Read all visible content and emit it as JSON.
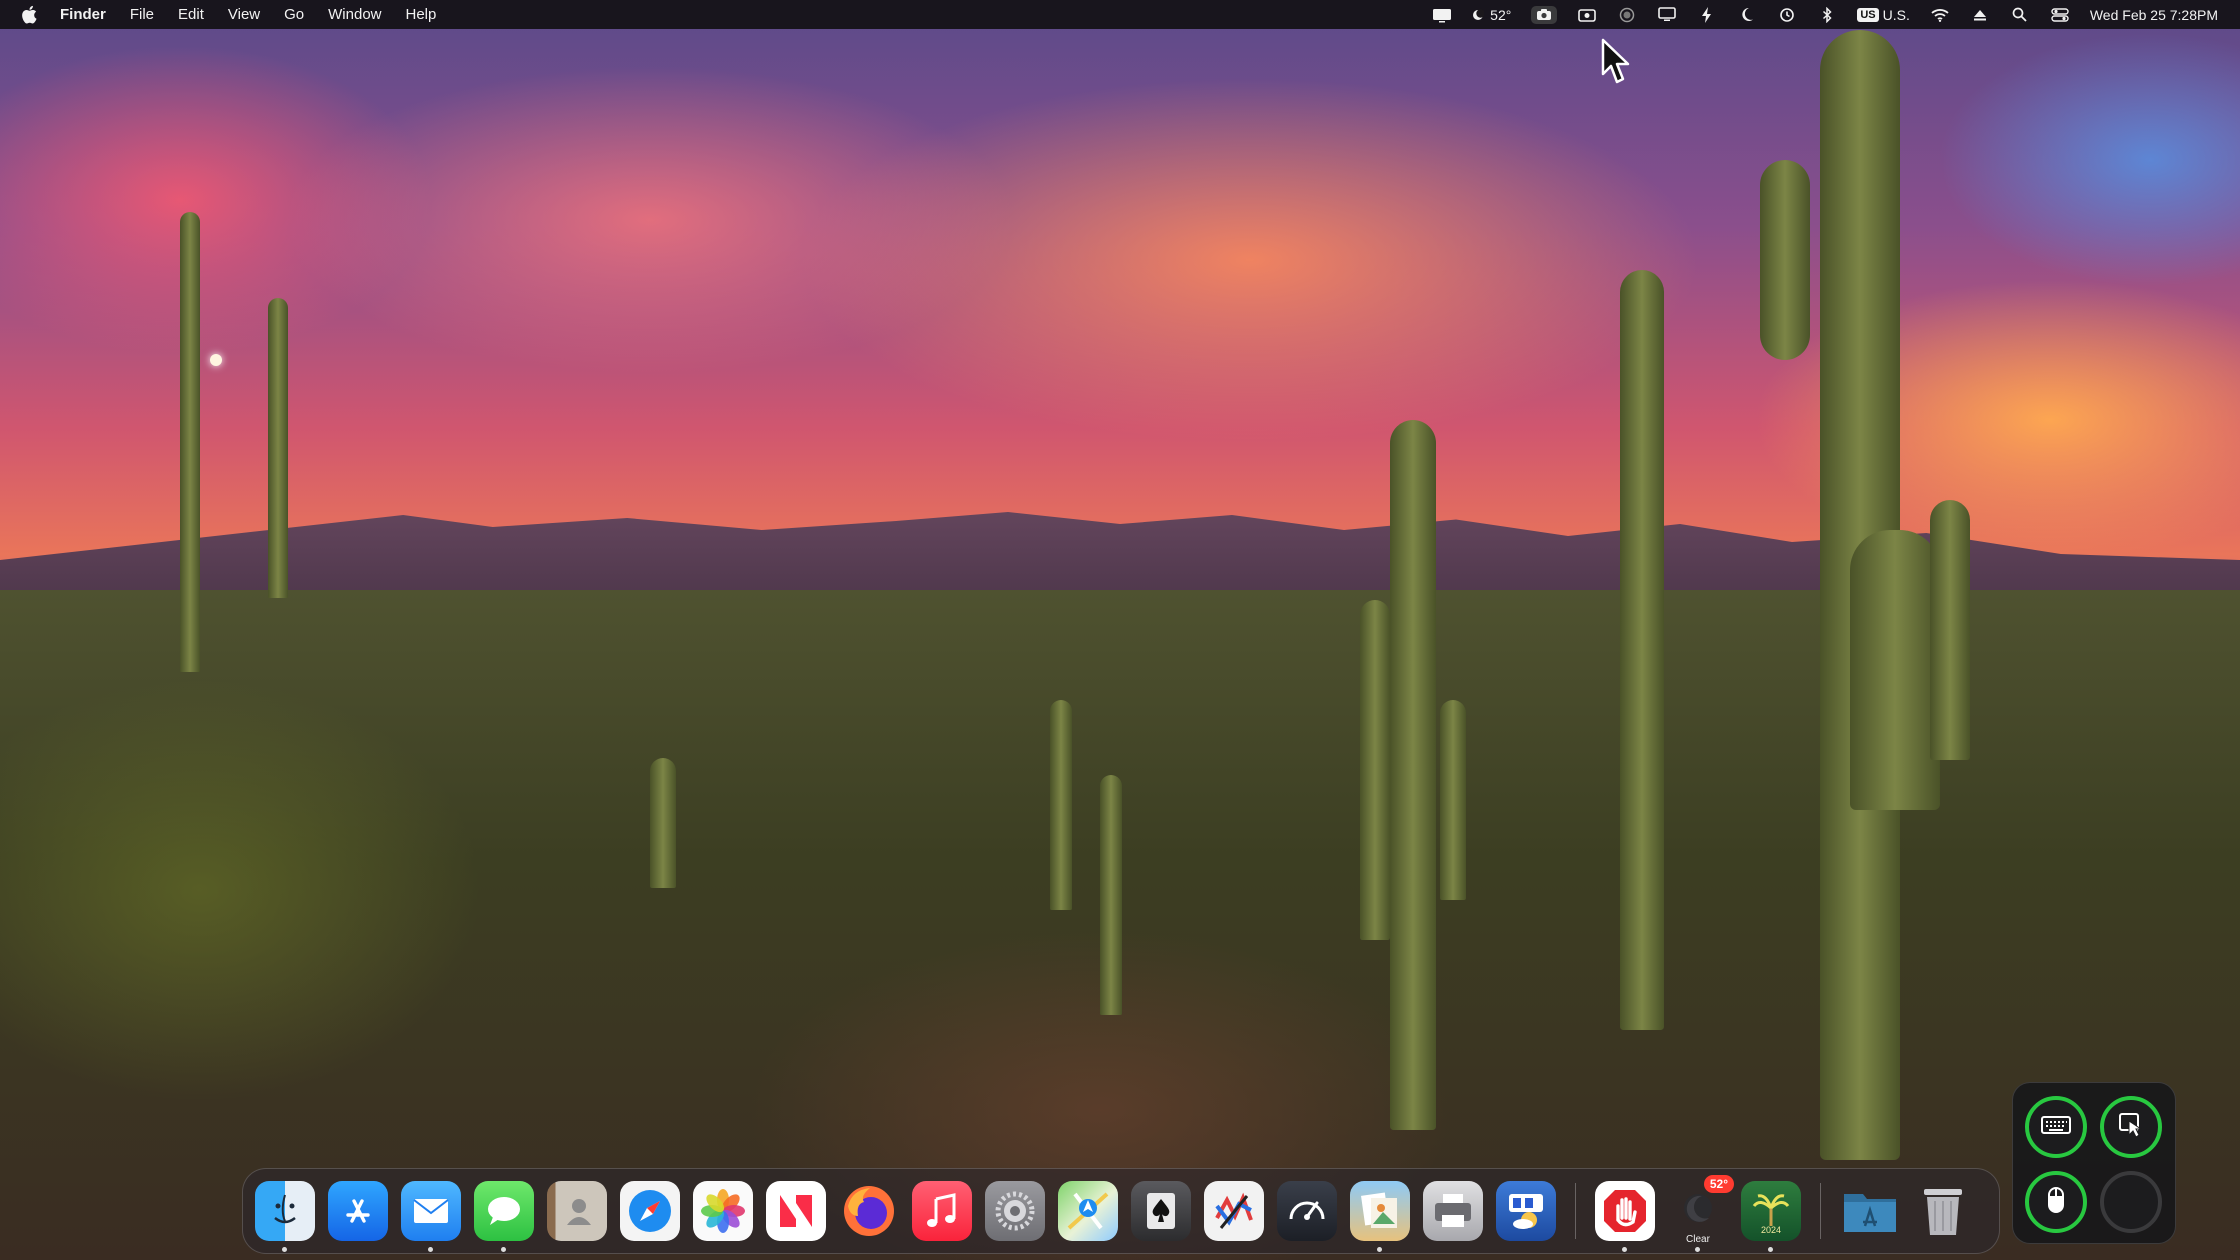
{
  "menubar": {
    "apple_icon": "apple-logo-icon",
    "items": [
      {
        "label": "Finder"
      },
      {
        "label": "File"
      },
      {
        "label": "Edit"
      },
      {
        "label": "View"
      },
      {
        "label": "Go"
      },
      {
        "label": "Window"
      },
      {
        "label": "Help"
      }
    ],
    "status": {
      "weather_temp": "52°",
      "keyboard_flag": "US",
      "keyboard_label": "U.S.",
      "datetime": "Wed Feb 25  7:28PM"
    }
  },
  "dock": {
    "apps": [
      {
        "name": "Finder",
        "icon": "finder-icon",
        "running": true
      },
      {
        "name": "App Store",
        "icon": "app-store-icon",
        "running": false
      },
      {
        "name": "Mail",
        "icon": "mail-icon",
        "running": true
      },
      {
        "name": "Messages",
        "icon": "messages-icon",
        "running": true
      },
      {
        "name": "Contacts",
        "icon": "contacts-icon",
        "running": false
      },
      {
        "name": "Safari",
        "icon": "safari-icon",
        "running": false
      },
      {
        "name": "Photos",
        "icon": "photos-icon",
        "running": false
      },
      {
        "name": "News",
        "icon": "news-icon",
        "running": false
      },
      {
        "name": "Firefox",
        "icon": "firefox-icon",
        "running": false
      },
      {
        "name": "Music",
        "icon": "music-icon",
        "running": false
      },
      {
        "name": "System Settings",
        "icon": "settings-gear-icon",
        "running": false
      },
      {
        "name": "Maps",
        "icon": "maps-icon",
        "running": false
      },
      {
        "name": "Solitaire",
        "icon": "spade-card-icon",
        "running": false
      },
      {
        "name": "Grapher",
        "icon": "grapher-icon",
        "running": false
      },
      {
        "name": "Activity Monitor",
        "icon": "speedometer-icon",
        "running": false
      },
      {
        "name": "Preview",
        "icon": "preview-icon",
        "running": true
      },
      {
        "name": "Printer",
        "icon": "printer-icon",
        "running": false
      },
      {
        "name": "Calendar Widget",
        "icon": "calendar-weather-icon",
        "running": false
      }
    ],
    "extra": [
      {
        "name": "Stop",
        "icon": "stop-hand-icon",
        "running": true
      },
      {
        "name": "Weather",
        "icon": "weather-moon-icon",
        "badge": "52°",
        "sublabel": "Clear",
        "running": true
      },
      {
        "name": "Almanac",
        "icon": "palm-tree-icon",
        "year": "2024",
        "running": true
      }
    ],
    "tail": [
      {
        "name": "Applications",
        "icon": "folder-icon"
      },
      {
        "name": "Trash",
        "icon": "trash-icon"
      }
    ]
  },
  "palette": {
    "buttons": [
      {
        "name": "Keyboard",
        "icon": "keyboard-icon",
        "active": true
      },
      {
        "name": "Pointer",
        "icon": "pointer-window-icon",
        "active": true
      },
      {
        "name": "Mouse",
        "icon": "mouse-icon",
        "active": true
      },
      {
        "name": "Empty",
        "icon": "",
        "active": false
      }
    ]
  },
  "colors": {
    "accent_green": "#28c840",
    "menubar_bg": "#121014"
  }
}
